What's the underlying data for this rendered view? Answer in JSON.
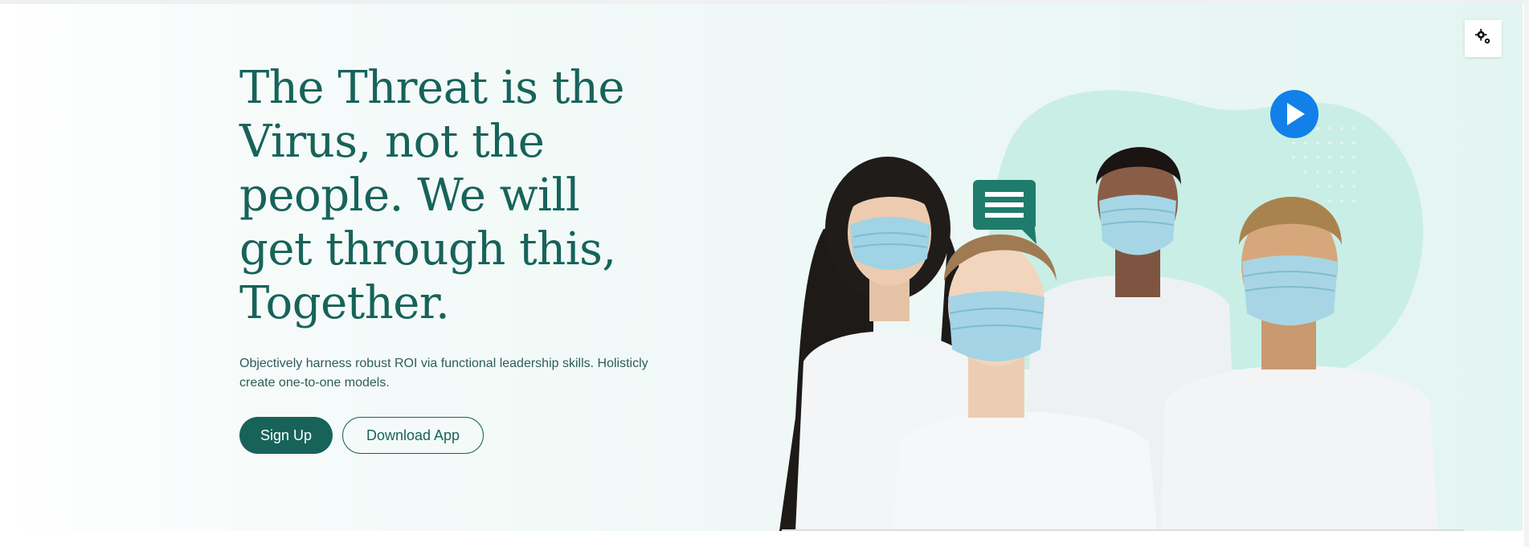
{
  "hero": {
    "headline": "The Threat is the Virus, not the people. We will get through this, Together.",
    "subtext": "Objectively harness robust ROI via functional leadership skills. Holisticly create one-to-one models.",
    "primary_button": "Sign Up",
    "secondary_button": "Download App"
  },
  "icons": {
    "settings": "gear-icon",
    "play": "play-icon",
    "chat": "chat-bubble-icon"
  },
  "colors": {
    "brand": "#17635a",
    "blob": "#c9eee6",
    "play": "#1180e8",
    "chat": "#1f7c6c"
  }
}
